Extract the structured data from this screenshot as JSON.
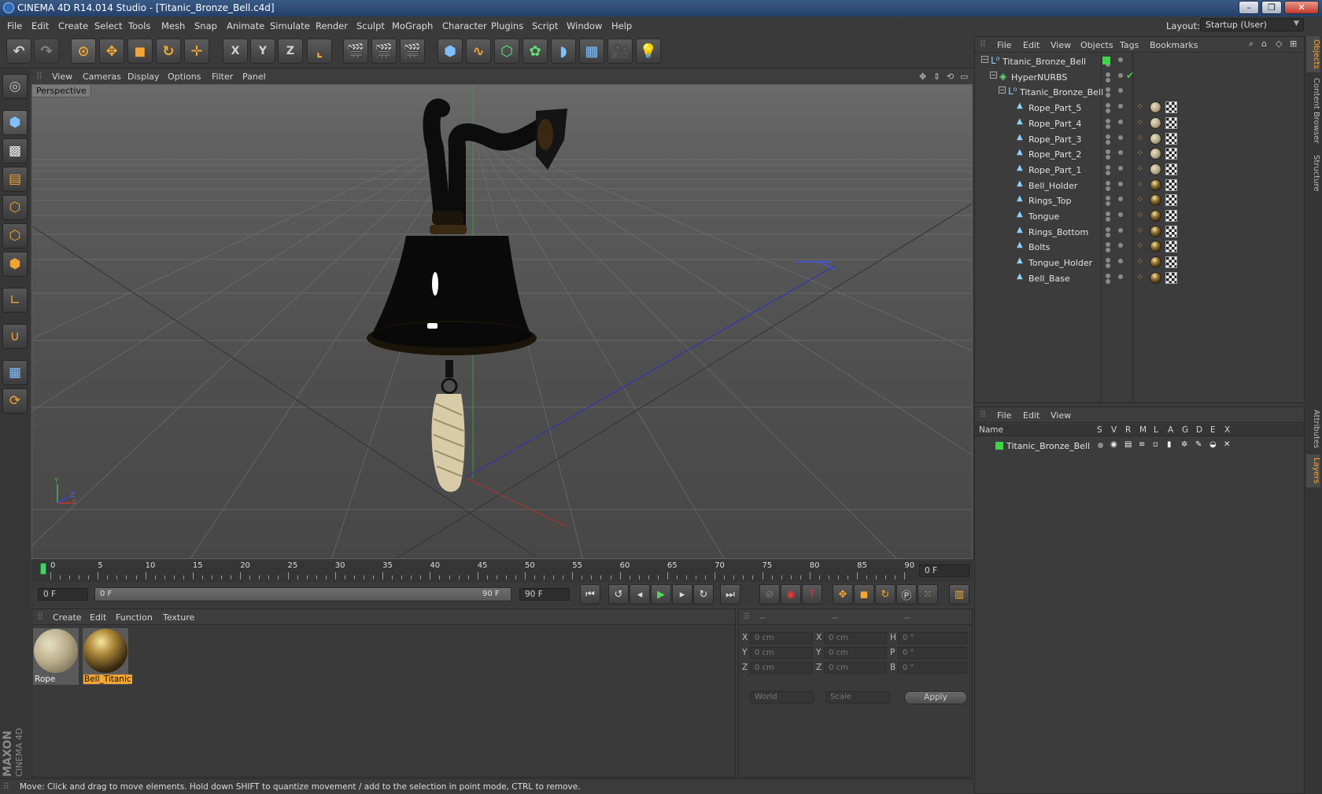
{
  "app": {
    "title": "CINEMA 4D R14.014 Studio - [Titanic_Bronze_Bell.c4d]",
    "window_buttons": [
      "–",
      "❐",
      "✕"
    ]
  },
  "menubar": {
    "items": [
      "File",
      "Edit",
      "Create",
      "Select",
      "Tools",
      "Mesh",
      "Snap",
      "Animate",
      "Simulate",
      "Render",
      "Sculpt",
      "MoGraph",
      "Character",
      "Plugins",
      "Script",
      "Window",
      "Help"
    ],
    "layout_label": "Layout:",
    "layout_value": "Startup (User)"
  },
  "toolbar": {
    "axis": [
      "X",
      "Y",
      "Z"
    ]
  },
  "viewport": {
    "menu": [
      "View",
      "Cameras",
      "Display",
      "Options",
      "Filter",
      "Panel"
    ],
    "label": "Perspective",
    "axis_labels": [
      "Y",
      "Z",
      "X"
    ]
  },
  "timeline": {
    "ticks": [
      "0",
      "5",
      "10",
      "15",
      "20",
      "25",
      "30",
      "35",
      "40",
      "45",
      "50",
      "55",
      "60",
      "65",
      "70",
      "75",
      "80",
      "85",
      "90"
    ],
    "frame_display": "0 F"
  },
  "transport": {
    "start_field": "0 F",
    "range_start": "0 F",
    "range_end": "90 F",
    "end_field": "90 F"
  },
  "materials": {
    "menu": [
      "Create",
      "Edit",
      "Function",
      "Texture"
    ],
    "items": [
      {
        "name": "Rope",
        "selected": false
      },
      {
        "name": "Bell_Titanic",
        "selected": true
      }
    ]
  },
  "coords": {
    "headers": [
      "--",
      "--",
      "--"
    ],
    "rows": [
      {
        "a": "X",
        "av": "0 cm",
        "b": "X",
        "bv": "0 cm",
        "c": "H",
        "cv": "0 °"
      },
      {
        "a": "Y",
        "av": "0 cm",
        "b": "Y",
        "bv": "0 cm",
        "c": "P",
        "cv": "0 °"
      },
      {
        "a": "Z",
        "av": "0 cm",
        "b": "Z",
        "bv": "0 cm",
        "c": "B",
        "cv": "0 °"
      }
    ],
    "mode1": "World",
    "mode2": "Scale",
    "apply": "Apply"
  },
  "objects": {
    "menu": [
      "File",
      "Edit",
      "View",
      "Objects",
      "Tags",
      "Bookmarks"
    ],
    "tree": [
      {
        "name": "Titanic_Bronze_Bell",
        "indent": 0,
        "icon": "null",
        "tags": "green"
      },
      {
        "name": "HyperNURBS",
        "indent": 1,
        "icon": "nurbs",
        "tags": "check"
      },
      {
        "name": "Titanic_Bronze_Bell",
        "indent": 2,
        "icon": "null",
        "tags": "none"
      },
      {
        "name": "Rope_Part_5",
        "indent": 3,
        "icon": "poly",
        "tags": "rope"
      },
      {
        "name": "Rope_Part_4",
        "indent": 3,
        "icon": "poly",
        "tags": "rope"
      },
      {
        "name": "Rope_Part_3",
        "indent": 3,
        "icon": "poly",
        "tags": "rope"
      },
      {
        "name": "Rope_Part_2",
        "indent": 3,
        "icon": "poly",
        "tags": "rope"
      },
      {
        "name": "Rope_Part_1",
        "indent": 3,
        "icon": "poly",
        "tags": "rope"
      },
      {
        "name": "Bell_Holder",
        "indent": 3,
        "icon": "poly",
        "tags": "bell"
      },
      {
        "name": "Rings_Top",
        "indent": 3,
        "icon": "poly",
        "tags": "bell"
      },
      {
        "name": "Tongue",
        "indent": 3,
        "icon": "poly",
        "tags": "bell"
      },
      {
        "name": "Rings_Bottom",
        "indent": 3,
        "icon": "poly",
        "tags": "bell"
      },
      {
        "name": "Bolts",
        "indent": 3,
        "icon": "poly",
        "tags": "bell"
      },
      {
        "name": "Tongue_Holder",
        "indent": 3,
        "icon": "poly",
        "tags": "bell"
      },
      {
        "name": "Bell_Base",
        "indent": 3,
        "icon": "poly",
        "tags": "bell"
      }
    ]
  },
  "layers": {
    "menu": [
      "File",
      "Edit",
      "View"
    ],
    "columns": [
      "Name",
      "S",
      "V",
      "R",
      "M",
      "L",
      "A",
      "G",
      "D",
      "E",
      "X"
    ],
    "rows": [
      "Titanic_Bronze_Bell"
    ]
  },
  "sidetabs": [
    "Objects",
    "Content Browser",
    "Structure",
    "Attributes",
    "Layers"
  ],
  "brand": {
    "maxon": "MAXON",
    "cinema": "CINEMA 4D"
  },
  "status": "Move: Click and drag to move elements. Hold down SHIFT to quantize movement / add to the selection in point mode, CTRL to remove.",
  "colors": {
    "accent": "#f4a634",
    "selected_mat": "#f4a634",
    "green_tag": "#3fd34a"
  }
}
